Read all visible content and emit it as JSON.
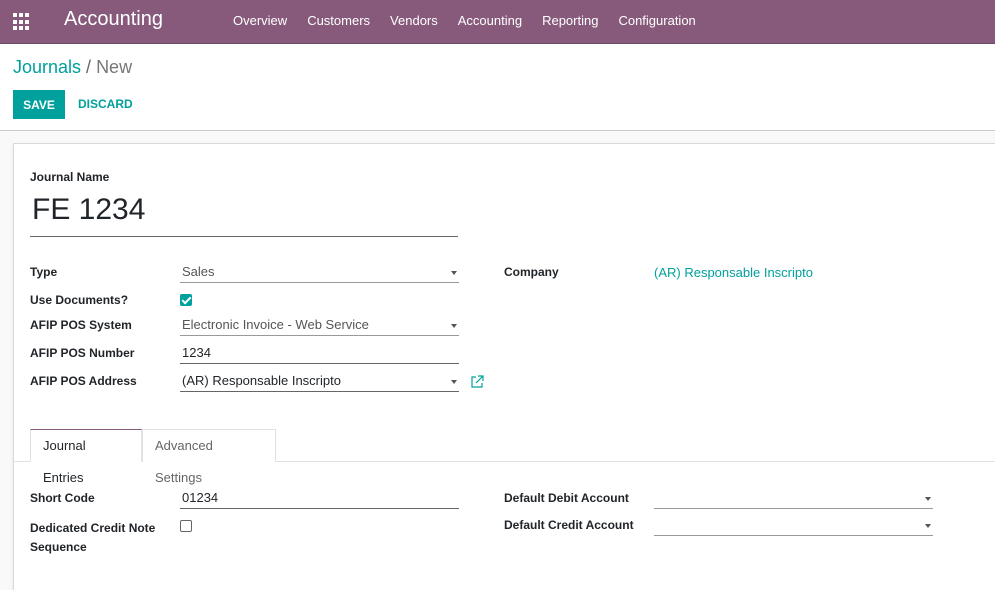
{
  "app": {
    "title": "Accounting"
  },
  "nav": {
    "items": [
      "Overview",
      "Customers",
      "Vendors",
      "Accounting",
      "Reporting",
      "Configuration"
    ]
  },
  "breadcrumb": {
    "parent": "Journals",
    "separator": "/",
    "current": "New"
  },
  "actions": {
    "save": "SAVE",
    "discard": "DISCARD"
  },
  "form": {
    "name_label": "Journal Name",
    "name_value": "FE 1234",
    "type_label": "Type",
    "type_value": "Sales",
    "use_documents_label": "Use Documents?",
    "use_documents_checked": true,
    "pos_system_label": "AFIP POS System",
    "pos_system_value": "Electronic Invoice - Web Service",
    "pos_number_label": "AFIP POS Number",
    "pos_number_value": "1234",
    "pos_address_label": "AFIP POS Address",
    "pos_address_value": "(AR) Responsable Inscripto",
    "company_label": "Company",
    "company_value": "(AR) Responsable Inscripto"
  },
  "tabs": [
    {
      "label": "Journal Entries",
      "active": true
    },
    {
      "label": "Advanced Settings",
      "active": false
    }
  ],
  "journal_entries": {
    "short_code_label": "Short Code",
    "short_code_value": "01234",
    "dedicated_credit_note_label_line1": "Dedicated Credit Note",
    "dedicated_credit_note_label_line2": "Sequence",
    "dedicated_credit_note_checked": false,
    "default_debit_label": "Default Debit Account",
    "default_debit_value": "",
    "default_credit_label": "Default Credit Account",
    "default_credit_value": ""
  },
  "colors": {
    "brand": "#875a7b",
    "accent": "#00a09d"
  }
}
